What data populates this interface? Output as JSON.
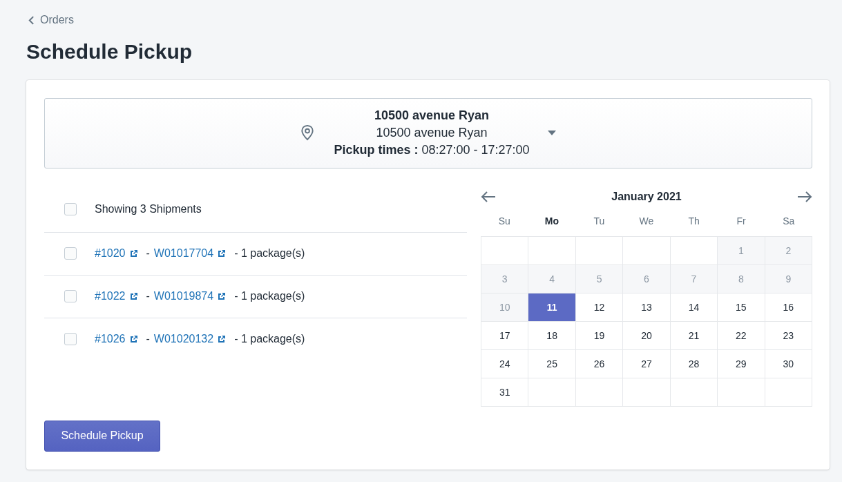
{
  "breadcrumb": "Orders",
  "title": "Schedule Pickup",
  "location": {
    "name": "10500 avenue Ryan",
    "address": "10500 avenue Ryan",
    "hours": "**Pickup times :** 08:27:00 - 17:27:00"
  },
  "shipments": {
    "header": {
      "label": "Showing 3 Shipments",
      "checked": false
    },
    "rows": [
      {
        "order": "#1020",
        "tracking": "W01017704",
        "packages": "- 1 package(s)",
        "checked": false
      },
      {
        "order": "#1022",
        "tracking": "W01019874",
        "packages": "- 1 package(s)",
        "checked": false
      },
      {
        "order": "#1026",
        "tracking": "W01020132",
        "packages": "- 1 package(s)",
        "checked": false
      }
    ]
  },
  "separator": "-",
  "calendar": {
    "month": "January 2021",
    "weekdays": [
      {
        "label": "Su",
        "current": false
      },
      {
        "label": "Mo",
        "current": true
      },
      {
        "label": "Tu",
        "current": false
      },
      {
        "label": "We",
        "current": false
      },
      {
        "label": "Th",
        "current": false
      },
      {
        "label": "Fr",
        "current": false
      },
      {
        "label": "Sa",
        "current": false
      }
    ],
    "weeks": [
      [
        {
          "kind": "blank"
        },
        {
          "kind": "blank"
        },
        {
          "kind": "blank"
        },
        {
          "kind": "blank"
        },
        {
          "kind": "blank"
        },
        {
          "kind": "day",
          "day": "1",
          "disabled": true,
          "selected": false
        },
        {
          "kind": "day",
          "day": "2",
          "disabled": true,
          "selected": false
        }
      ],
      [
        {
          "kind": "day",
          "day": "3",
          "disabled": true,
          "selected": false
        },
        {
          "kind": "day",
          "day": "4",
          "disabled": true,
          "selected": false
        },
        {
          "kind": "day",
          "day": "5",
          "disabled": true,
          "selected": false
        },
        {
          "kind": "day",
          "day": "6",
          "disabled": true,
          "selected": false
        },
        {
          "kind": "day",
          "day": "7",
          "disabled": true,
          "selected": false
        },
        {
          "kind": "day",
          "day": "8",
          "disabled": true,
          "selected": false
        },
        {
          "kind": "day",
          "day": "9",
          "disabled": true,
          "selected": false
        }
      ],
      [
        {
          "kind": "day",
          "day": "10",
          "disabled": true,
          "selected": false
        },
        {
          "kind": "day",
          "day": "11",
          "disabled": false,
          "selected": true
        },
        {
          "kind": "day",
          "day": "12",
          "disabled": false,
          "selected": false
        },
        {
          "kind": "day",
          "day": "13",
          "disabled": false,
          "selected": false
        },
        {
          "kind": "day",
          "day": "14",
          "disabled": false,
          "selected": false
        },
        {
          "kind": "day",
          "day": "15",
          "disabled": false,
          "selected": false
        },
        {
          "kind": "day",
          "day": "16",
          "disabled": false,
          "selected": false
        }
      ],
      [
        {
          "kind": "day",
          "day": "17",
          "disabled": false,
          "selected": false
        },
        {
          "kind": "day",
          "day": "18",
          "disabled": false,
          "selected": false
        },
        {
          "kind": "day",
          "day": "19",
          "disabled": false,
          "selected": false
        },
        {
          "kind": "day",
          "day": "20",
          "disabled": false,
          "selected": false
        },
        {
          "kind": "day",
          "day": "21",
          "disabled": false,
          "selected": false
        },
        {
          "kind": "day",
          "day": "22",
          "disabled": false,
          "selected": false
        },
        {
          "kind": "day",
          "day": "23",
          "disabled": false,
          "selected": false
        }
      ],
      [
        {
          "kind": "day",
          "day": "24",
          "disabled": false,
          "selected": false
        },
        {
          "kind": "day",
          "day": "25",
          "disabled": false,
          "selected": false
        },
        {
          "kind": "day",
          "day": "26",
          "disabled": false,
          "selected": false
        },
        {
          "kind": "day",
          "day": "27",
          "disabled": false,
          "selected": false
        },
        {
          "kind": "day",
          "day": "28",
          "disabled": false,
          "selected": false
        },
        {
          "kind": "day",
          "day": "29",
          "disabled": false,
          "selected": false
        },
        {
          "kind": "day",
          "day": "30",
          "disabled": false,
          "selected": false
        }
      ],
      [
        {
          "kind": "day",
          "day": "31",
          "disabled": false,
          "selected": false
        },
        {
          "kind": "blank"
        },
        {
          "kind": "blank"
        },
        {
          "kind": "blank"
        },
        {
          "kind": "blank"
        },
        {
          "kind": "blank"
        },
        {
          "kind": "blank"
        }
      ]
    ]
  },
  "action": "Schedule Pickup"
}
